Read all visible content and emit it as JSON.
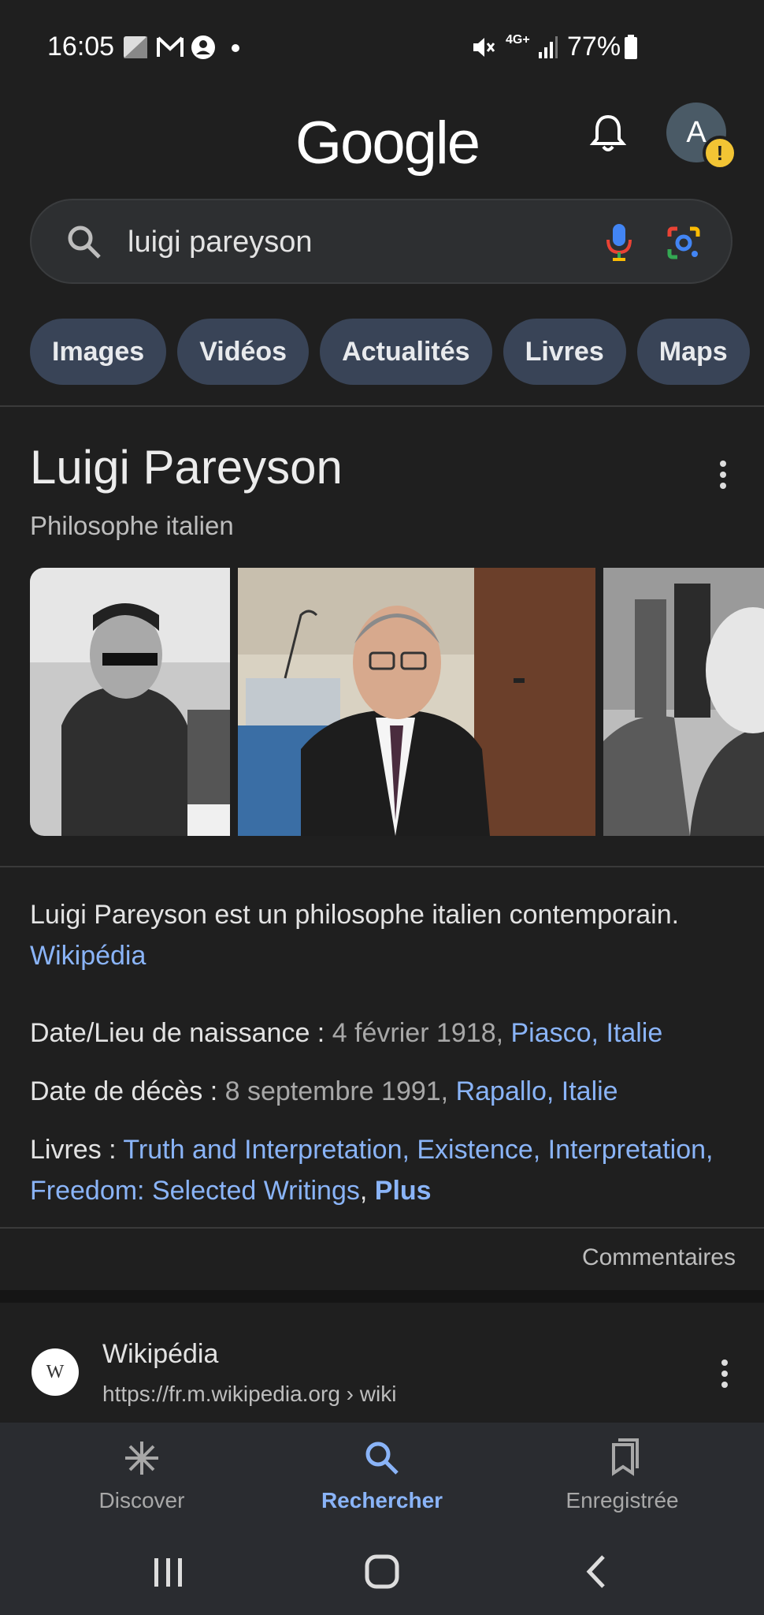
{
  "status_bar": {
    "time": "16:05",
    "battery": "77%",
    "network": "4G+"
  },
  "header": {
    "logo": "Google",
    "avatar_letter": "A"
  },
  "search": {
    "query": "luigi pareyson"
  },
  "chips": [
    "Images",
    "Vidéos",
    "Actualités",
    "Livres",
    "Maps"
  ],
  "knowledge_panel": {
    "title": "Luigi Pareyson",
    "subtitle": "Philosophe italien",
    "description": "Luigi Pareyson est un philosophe italien contemporain.",
    "source": "Wikipédia",
    "birth_label": "Date/Lieu de naissance : ",
    "birth_date": "4 février 1918, ",
    "birth_place": "Piasco, Italie",
    "death_label": "Date de décès : ",
    "death_date": "8 septembre 1991, ",
    "death_place": "Rapallo, Italie",
    "books_label": "Livres : ",
    "books": "Truth and Interpretation, Existence, Interpretation, Freedom: Selected Writings",
    "books_sep": ", ",
    "more": "Plus",
    "feedback": "Commentaires"
  },
  "result": {
    "site_name": "Wikipédia",
    "url": "https://fr.m.wikipedia.org",
    "path": " › wiki",
    "favicon": "W"
  },
  "bottom_nav": {
    "discover": "Discover",
    "search": "Rechercher",
    "saved": "Enregistrée"
  },
  "colors": {
    "background": "#1f1f1f",
    "link": "#8ab4f8",
    "chip": "#394457"
  }
}
